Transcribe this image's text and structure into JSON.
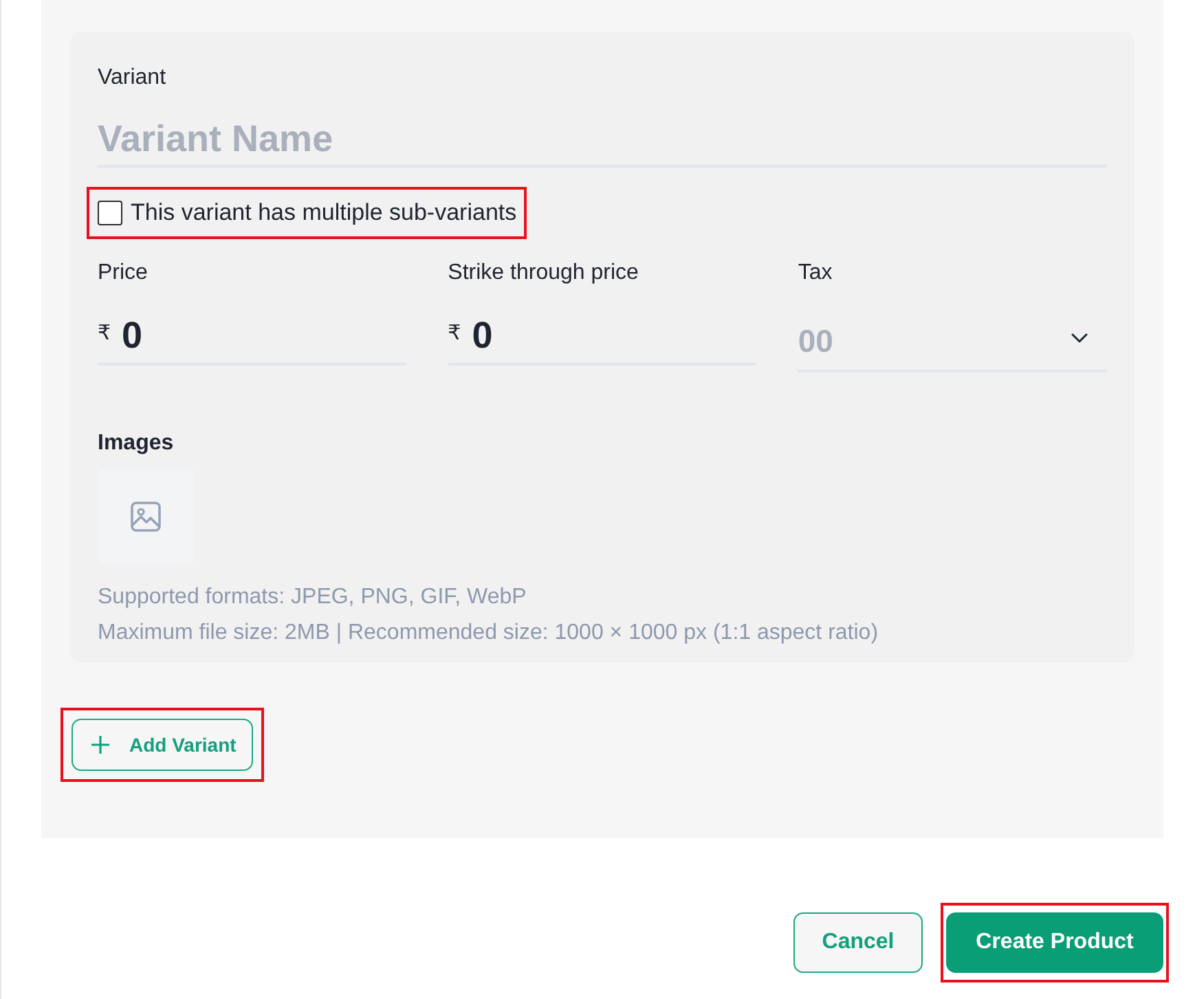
{
  "variant": {
    "label": "Variant",
    "name_placeholder": "Variant Name"
  },
  "sub_variants": {
    "label": "This variant has multiple sub-variants",
    "checked": false,
    "highlighted": true
  },
  "pricing": [
    {
      "kind": "currency",
      "label": "Price",
      "currency": "₹",
      "value": "0"
    },
    {
      "kind": "currency",
      "label": "Strike through price",
      "currency": "₹",
      "value": "0"
    },
    {
      "kind": "select",
      "label": "Tax",
      "placeholder": "00"
    }
  ],
  "images": {
    "label": "Images",
    "help": [
      "Supported formats: JPEG, PNG, GIF, WebP",
      "Maximum file size: 2MB | Recommended size: 1000 × 1000 px (1:1 aspect ratio)"
    ]
  },
  "add_variant": {
    "label": "Add Variant",
    "highlighted": true
  },
  "actions": [
    {
      "kind": "secondary",
      "label": "Cancel",
      "highlighted": false
    },
    {
      "kind": "primary",
      "label": "Create Product",
      "highlighted": true
    }
  ]
}
